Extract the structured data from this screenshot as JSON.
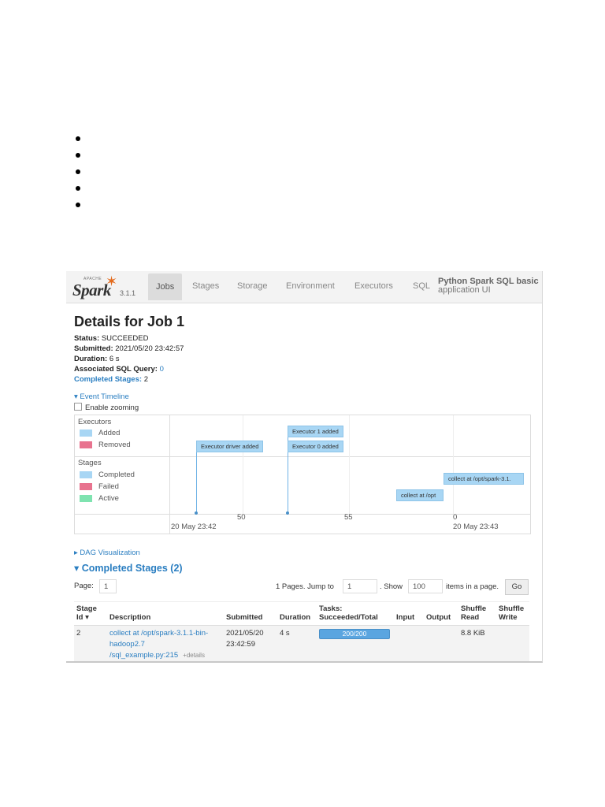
{
  "bullets": [
    "",
    "",
    "",
    "",
    ""
  ],
  "navbar": {
    "brand_apache": "APACHE",
    "brand_name": "Spark",
    "version": "3.1.1",
    "tabs": [
      {
        "label": "Jobs",
        "active": true
      },
      {
        "label": "Stages",
        "active": false
      },
      {
        "label": "Storage",
        "active": false
      },
      {
        "label": "Environment",
        "active": false
      },
      {
        "label": "Executors",
        "active": false
      },
      {
        "label": "SQL",
        "active": false
      }
    ],
    "app_name_line1": "Python Spark SQL basic",
    "app_name_line2": "application UI"
  },
  "job": {
    "title": "Details for Job 1",
    "status_label": "Status:",
    "status_value": "SUCCEEDED",
    "submitted_label": "Submitted:",
    "submitted_value": "2021/05/20 23:42:57",
    "duration_label": "Duration:",
    "duration_value": "6 s",
    "sql_label": "Associated SQL Query:",
    "sql_value": "0",
    "completed_label": "Completed Stages:",
    "completed_value": "2"
  },
  "timeline": {
    "toggle_label": "Event Timeline",
    "zoom_label": "Enable zooming",
    "executors_header": "Executors",
    "legend_added": "Added",
    "legend_removed": "Removed",
    "stages_header": "Stages",
    "legend_completed": "Completed",
    "legend_failed": "Failed",
    "legend_active": "Active",
    "events": {
      "executor_driver": "Executor driver added",
      "executor_1": "Executor 1 added",
      "executor_0": "Executor 0 added",
      "stage_collect_1": "collect at /opt/spark-3.1.",
      "stage_collect_2": "collect at /opt"
    },
    "ticks": {
      "t1_date": "20 May 23:42",
      "t50": "50",
      "t55": "55",
      "t0": "0",
      "t0_date": "20 May 23:43"
    }
  },
  "dag_label": "DAG Visualization",
  "completed_stages_title": "Completed Stages (2)",
  "pager": {
    "page_label": "Page:",
    "page_value": "1",
    "pages_text": "1 Pages. Jump to",
    "jump_value": "1",
    "show_label": ". Show",
    "show_value": "100",
    "items_text": "items in a page.",
    "go_label": "Go"
  },
  "table": {
    "headers": {
      "stage_id_1": "Stage",
      "stage_id_2": "Id ▾",
      "description": "Description",
      "submitted": "Submitted",
      "duration": "Duration",
      "tasks_1": "Tasks:",
      "tasks_2": "Succeeded/Total",
      "input": "Input",
      "output": "Output",
      "shuffle_read_1": "Shuffle",
      "shuffle_read_2": "Read",
      "shuffle_write_1": "Shuffle",
      "shuffle_write_2": "Write"
    },
    "rows": [
      {
        "stage_id": "2",
        "description_line1": "collect at /opt/spark-3.1.1-bin-",
        "description_line2": "hadoop2.7",
        "description_line3": "/sql_example.py:215",
        "details": "+details",
        "submitted_line1": "2021/05/20",
        "submitted_line2": "23:42:59",
        "duration": "4 s",
        "tasks": "200/200",
        "tasks_fraction": 1.0,
        "input": "",
        "output": "",
        "shuffle_read": "8.8 KiB",
        "shuffle_write": ""
      }
    ]
  },
  "colors": {
    "link": "#2a7ec1",
    "executor_added": "#a8d6f4",
    "executor_removed": "#e8738f",
    "stage_completed": "#a8d6f4",
    "stage_failed": "#e8738f",
    "stage_active": "#7fe3b0"
  }
}
